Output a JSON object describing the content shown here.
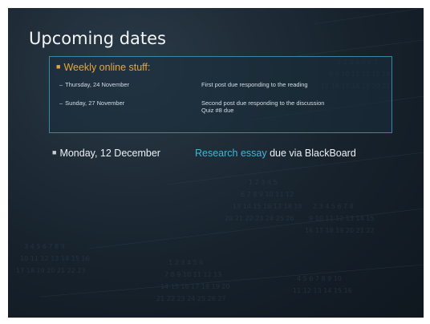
{
  "slide": {
    "title": "Upcoming dates",
    "weekly": {
      "heading": "Weekly online stuff:",
      "items": [
        {
          "date": "Thursday, 24 November",
          "desc": [
            "First post due responding to the reading"
          ]
        },
        {
          "date": "Sunday, 27 November",
          "desc": [
            "Second post due responding to the discussion",
            "Quiz #8 due"
          ]
        }
      ]
    },
    "deadline": {
      "date": "Monday, 12 December",
      "link_text": "Research essay",
      "rest_text": " due via BlackBoard"
    }
  },
  "colors": {
    "background": "#17222c",
    "accent_orange": "#e8a63a",
    "accent_blue": "#47b3d6",
    "box_border": "#3a87a8"
  }
}
